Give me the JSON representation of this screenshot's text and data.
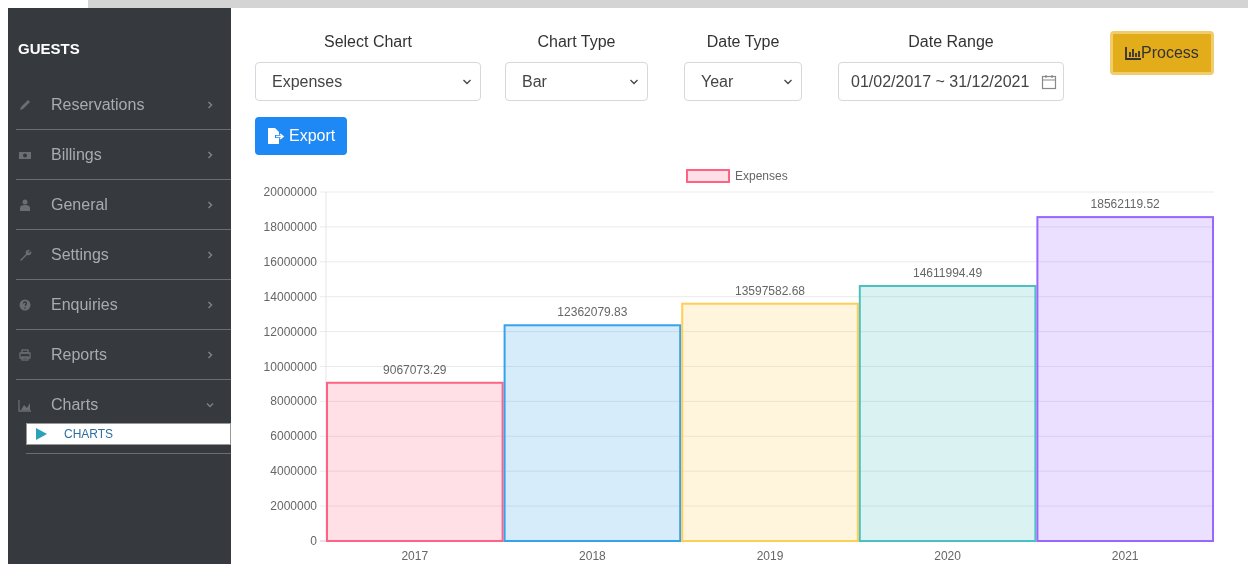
{
  "sidebar": {
    "title": "GUESTS",
    "items": [
      {
        "label": "Reservations",
        "expanded": false
      },
      {
        "label": "Billings",
        "expanded": false
      },
      {
        "label": "General",
        "expanded": false
      },
      {
        "label": "Settings",
        "expanded": false
      },
      {
        "label": "Enquiries",
        "expanded": false
      },
      {
        "label": "Reports",
        "expanded": false
      },
      {
        "label": "Charts",
        "expanded": true,
        "children": [
          {
            "label": "CHARTS",
            "selected": true
          }
        ]
      }
    ]
  },
  "filters": [
    {
      "label": "Select Chart",
      "kind": "select",
      "value": "Expenses"
    },
    {
      "label": "Chart Type",
      "kind": "select",
      "value": "Bar"
    },
    {
      "label": "Date Type",
      "kind": "select",
      "value": "Year"
    },
    {
      "label": "Date Range",
      "kind": "date",
      "value": "01/02/2017 ~ 31/12/2021"
    }
  ],
  "process_button": "Process",
  "export_button": "Export",
  "chart": {
    "chart_data": {
      "type": "bar",
      "categories": [
        "2017",
        "2018",
        "2019",
        "2020",
        "2021"
      ],
      "series": [
        {
          "name": "Expenses",
          "color": "#ff6384",
          "colors": [
            "#ff6384",
            "#36a2eb",
            "#ffce56",
            "#4bc0c0",
            "#9966ff"
          ],
          "values": [
            9067073.29,
            12362079.83,
            13597582.68,
            14611994.49,
            18562119.52
          ]
        }
      ],
      "grid": true,
      "ylim": [
        0,
        20000000
      ],
      "yticks": [
        0,
        2000000,
        4000000,
        6000000,
        8000000,
        10000000,
        12000000,
        14000000,
        16000000,
        18000000,
        20000000
      ],
      "value_labels": [
        "9067073.29",
        "12362079.83",
        "13597582.68",
        "14611994.49",
        "18562119.52"
      ]
    }
  }
}
